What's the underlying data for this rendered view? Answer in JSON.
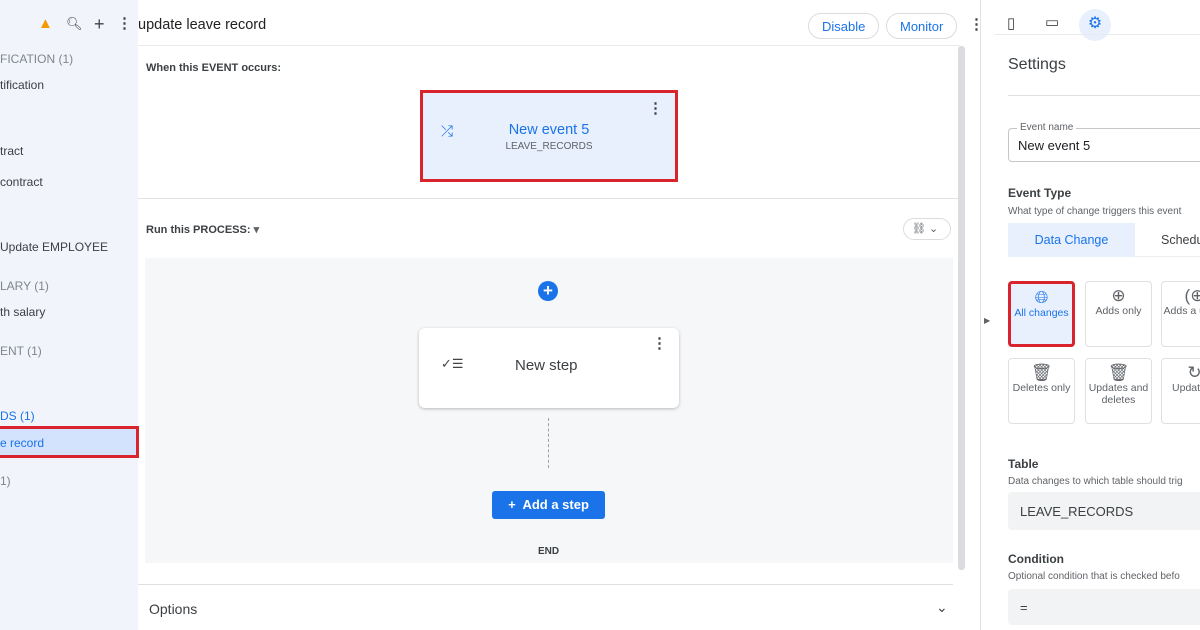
{
  "sidebar": {
    "items": [
      {
        "t": "FICATION (1)",
        "k": "h"
      },
      {
        "t": "tification",
        "k": "i"
      },
      {
        "t": "tract",
        "k": "i"
      },
      {
        "t": "contract",
        "k": "i"
      },
      {
        "t": "Update EMPLOYEE",
        "k": "i"
      },
      {
        "t": "LARY (1)",
        "k": "h"
      },
      {
        "t": "th salary",
        "k": "i"
      },
      {
        "t": "ENT (1)",
        "k": "h"
      },
      {
        "t": "DS (1)",
        "k": "h"
      },
      {
        "t": "1)",
        "k": "h"
      }
    ],
    "selected": "e record"
  },
  "header": {
    "title": "update leave record",
    "disable": "Disable",
    "monitor": "Monitor"
  },
  "event": {
    "heading": "When this EVENT occurs:",
    "name": "New event 5",
    "table": "LEAVE_RECORDS"
  },
  "process": {
    "heading": "Run this PROCESS:",
    "step": "New step",
    "add_step": "Add a step",
    "end": "END"
  },
  "options": "Options",
  "settings": {
    "title": "Settings",
    "event_name_label": "Event name",
    "event_name": "New event 5",
    "event_type": "Event Type",
    "event_type_desc": "What type of change triggers this event",
    "tabs": [
      "Data Change",
      "Schedu"
    ],
    "change_options": [
      "All changes",
      "Adds only",
      "Adds a updat",
      "Deletes only",
      "Updates and deletes",
      "Updat onl"
    ],
    "table_label": "Table",
    "table_desc": "Data changes to which table should trig",
    "table": "LEAVE_RECORDS",
    "condition_label": "Condition",
    "condition_desc": "Optional condition that is checked befo",
    "condition": "="
  }
}
